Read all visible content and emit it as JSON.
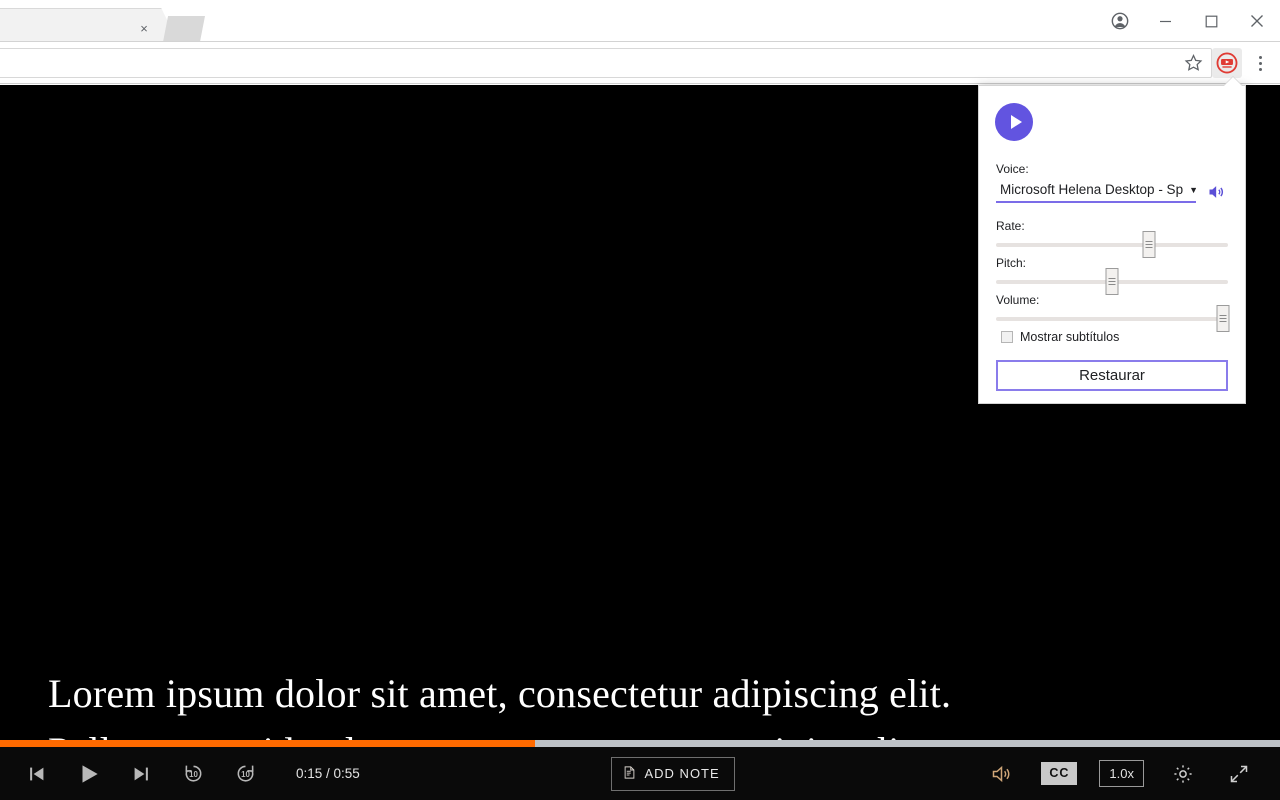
{
  "browser": {
    "tab": {
      "title": "",
      "close_label": "×",
      "new_tab_label": ""
    },
    "window_controls": {
      "profile": "profile-icon",
      "minimize": "—",
      "maximize": "□",
      "close": "×"
    },
    "omnibox": {
      "value": "",
      "placeholder": ""
    },
    "bookmark_star": "star-icon",
    "extension": {
      "name": "read-aloud-extension",
      "color": "#e03b34"
    },
    "menu": "three-dot-menu"
  },
  "popup": {
    "play_button_label": "▶",
    "voice": {
      "label": "Voice:",
      "selected": "Microsoft Helena Desktop - Sp",
      "caret": "▼",
      "preview_icon": "speaker-icon"
    },
    "rate": {
      "label": "Rate:",
      "value": 66
    },
    "pitch": {
      "label": "Pitch:",
      "value": 50
    },
    "volume": {
      "label": "Volume:",
      "value": 98
    },
    "subtitles_checkbox": {
      "label": "Mostrar subtítulos",
      "checked": false
    },
    "restore_button": "Restaurar",
    "accent_color": "#6254e0"
  },
  "video": {
    "subtitle_line1": "Lorem ipsum dolor sit amet, consectetur adipiscing elit.",
    "subtitle_line2": "Pellentesque id vulputate massa, rutrum suscipit velit.",
    "progress_percent": 41.8,
    "progress_color": "#ff6a00",
    "controls": {
      "previous": "skip-previous",
      "play": "play",
      "next": "skip-next",
      "rewind": "10",
      "forward": "10",
      "time": "0:15 / 0:55",
      "add_note": "ADD NOTE",
      "volume": "volume-icon",
      "captions": "CC",
      "speed": "1.0x",
      "settings": "gear-icon",
      "fullscreen": "fullscreen-icon"
    }
  }
}
